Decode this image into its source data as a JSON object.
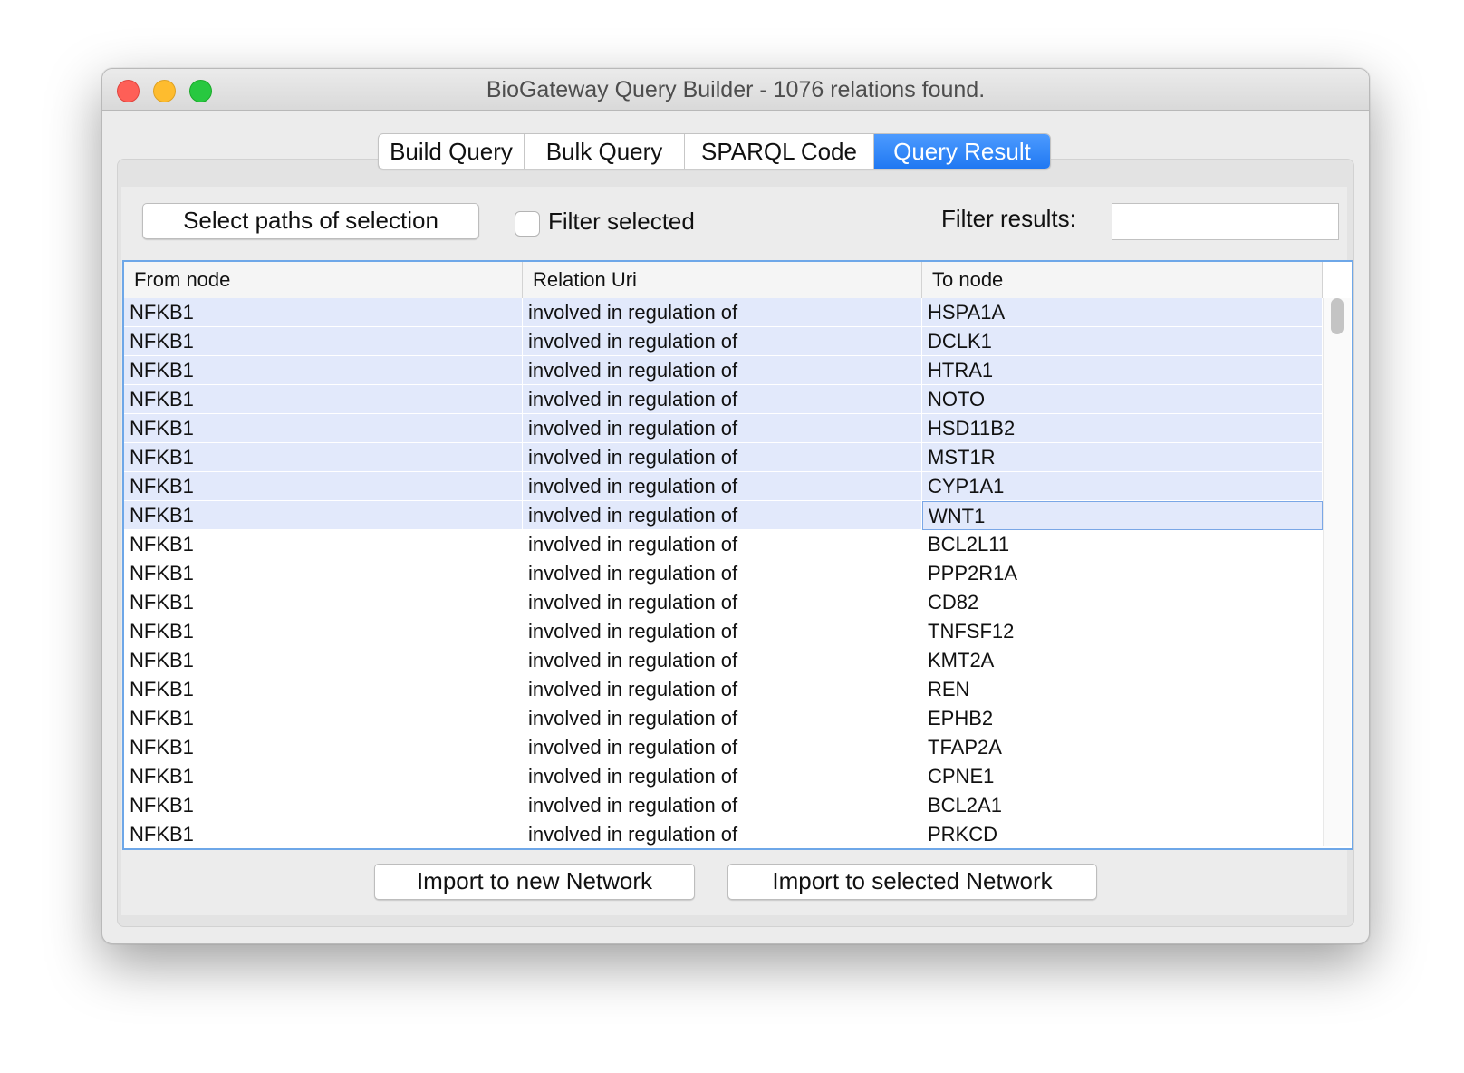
{
  "window": {
    "title": "BioGateway Query Builder - 1076 relations found."
  },
  "tabs": [
    {
      "label": "Build Query",
      "active": false
    },
    {
      "label": "Bulk Query",
      "active": false
    },
    {
      "label": "SPARQL Code",
      "active": false
    },
    {
      "label": "Query Result",
      "active": true
    }
  ],
  "toolbar": {
    "select_paths_label": "Select paths of selection",
    "filter_selected_label": "Filter selected",
    "filter_selected_checked": false,
    "filter_results_label": "Filter results:",
    "filter_results_value": ""
  },
  "table": {
    "columns": [
      "From node",
      "Relation Uri",
      "To node"
    ],
    "rows": [
      {
        "from": "NFKB1",
        "relation": "involved in regulation of",
        "to": "HSPA1A",
        "selected": true
      },
      {
        "from": "NFKB1",
        "relation": "involved in regulation of",
        "to": "DCLK1",
        "selected": true
      },
      {
        "from": "NFKB1",
        "relation": "involved in regulation of",
        "to": "HTRA1",
        "selected": true
      },
      {
        "from": "NFKB1",
        "relation": "involved in regulation of",
        "to": "NOTO",
        "selected": true
      },
      {
        "from": "NFKB1",
        "relation": "involved in regulation of",
        "to": "HSD11B2",
        "selected": true
      },
      {
        "from": "NFKB1",
        "relation": "involved in regulation of",
        "to": "MST1R",
        "selected": true
      },
      {
        "from": "NFKB1",
        "relation": "involved in regulation of",
        "to": "CYP1A1",
        "selected": true
      },
      {
        "from": "NFKB1",
        "relation": "involved in regulation of",
        "to": "WNT1",
        "selected": true
      },
      {
        "from": "NFKB1",
        "relation": "involved in regulation of",
        "to": "BCL2L11",
        "selected": false
      },
      {
        "from": "NFKB1",
        "relation": "involved in regulation of",
        "to": "PPP2R1A",
        "selected": false
      },
      {
        "from": "NFKB1",
        "relation": "involved in regulation of",
        "to": "CD82",
        "selected": false
      },
      {
        "from": "NFKB1",
        "relation": "involved in regulation of",
        "to": "TNFSF12",
        "selected": false
      },
      {
        "from": "NFKB1",
        "relation": "involved in regulation of",
        "to": "KMT2A",
        "selected": false
      },
      {
        "from": "NFKB1",
        "relation": "involved in regulation of",
        "to": "REN",
        "selected": false
      },
      {
        "from": "NFKB1",
        "relation": "involved in regulation of",
        "to": "EPHB2",
        "selected": false
      },
      {
        "from": "NFKB1",
        "relation": "involved in regulation of",
        "to": "TFAP2A",
        "selected": false
      },
      {
        "from": "NFKB1",
        "relation": "involved in regulation of",
        "to": "CPNE1",
        "selected": false
      },
      {
        "from": "NFKB1",
        "relation": "involved in regulation of",
        "to": "BCL2A1",
        "selected": false
      },
      {
        "from": "NFKB1",
        "relation": "involved in regulation of",
        "to": "PRKCD",
        "selected": false
      }
    ]
  },
  "footer": {
    "import_new_label": "Import to new Network",
    "import_selected_label": "Import to selected Network"
  }
}
